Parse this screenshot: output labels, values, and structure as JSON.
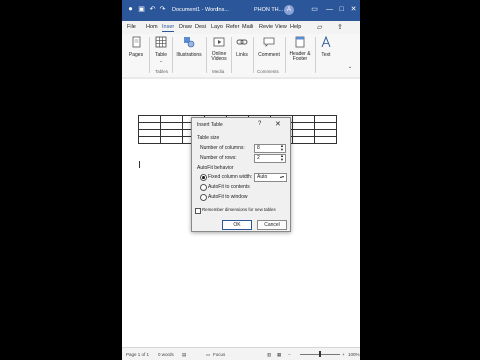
{
  "titlebar": {
    "doc_name": "Document1 - Word",
    "search": "Ins...",
    "user_name": "PHON TH...",
    "avatar_initial": "A",
    "window_controls": [
      "▭",
      "—",
      "□",
      "✕"
    ]
  },
  "ribbon_tabs": [
    "File",
    "Hom",
    "Inser",
    "Draw",
    "Desi",
    "Layo",
    "Refer",
    "Maili",
    "Revie",
    "View",
    "Help"
  ],
  "ribbon": {
    "pages": "Pages",
    "table": "Table",
    "illustrations": "Illustrations",
    "online_videos": "Online\nVideos",
    "links": "Links",
    "comment": "Comment",
    "header_footer": "Header &\nFooter",
    "text": "Text",
    "groups": {
      "tables": "Tables",
      "media": "Media",
      "comments": "Comments"
    }
  },
  "dialog": {
    "title": "Insert Table",
    "help": "?",
    "close": "✕",
    "table_size": "Table size",
    "num_columns_label": "Number of columns:",
    "num_columns_value": "8",
    "num_rows_label": "Number of rows:",
    "num_rows_value": "2",
    "autofit_label": "AutoFit behavior",
    "fixed_label": "Fixed column width:",
    "fixed_value": "Auto",
    "autofit_contents": "AutoFit to contents",
    "autofit_window": "AutoFit to window",
    "remember": "Remember dimensions for new tables",
    "ok": "OK",
    "cancel": "Cancel"
  },
  "statusbar": {
    "page": "Page 1 of 1",
    "words": "0 words",
    "focus": "Focus",
    "zoom": "100%"
  }
}
